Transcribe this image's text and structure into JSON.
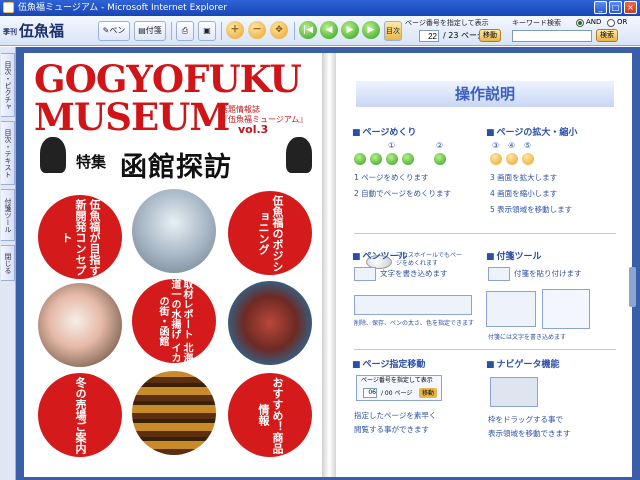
{
  "window": {
    "title": "伍魚福ミュージアム - Microsoft Internet Explorer",
    "buttons": {
      "minimize": "_",
      "maximize": "□",
      "close": "×"
    }
  },
  "toolbar": {
    "logo_small": "季刊",
    "logo_main": "伍魚福",
    "pen_label": "ペン",
    "sticky_label": "付箋",
    "icons": [
      "pen-icon",
      "sticky-icon",
      "print-icon",
      "pdf-icon",
      "zoom-in-icon",
      "zoom-out-icon",
      "move-icon",
      "first-page-icon",
      "prev-page-icon",
      "auto-play-icon",
      "next-page-icon",
      "last-page-icon",
      "index-icon"
    ],
    "zoom_symbols": [
      "＋",
      "－",
      "✥"
    ],
    "nav_symbols": [
      "|◀",
      "◀",
      "▶",
      "▶",
      "▶|"
    ],
    "index_label": "目次",
    "page_prompt": "ページ番号を指定して表示",
    "page_value": "22",
    "page_total": "/ 23 ページ",
    "go_label": "移動",
    "search_label": "キーワード検索",
    "search_and": "AND",
    "search_or": "OR",
    "search_btn": "検索"
  },
  "sidetabs": [
    "目次・ピクチャ",
    "目次・テキスト",
    "付箋ツール",
    "閉じる"
  ],
  "cover": {
    "title1": "GOGYOFUKU",
    "title2": "MUSEUM",
    "subtitle": "話題情報誌",
    "subtitle2": "『伍魚福ミュージアム』",
    "vol": "vol.3",
    "special_label": "特集",
    "special_title": "函館探訪",
    "circle1": "伍魚福が目指す新開発コンセプト",
    "circle2": "伍魚福のポジショニング",
    "circle3": "取材レポート 北海道一の水揚げ イカの街・函館",
    "circle4": "冬の売場ご案内",
    "circle5": "おすすめ！商品情報"
  },
  "howto": {
    "header": "操作説明",
    "sec_page": "ページめくり",
    "page_nums": [
      "①",
      "②"
    ],
    "page_items": [
      "1 ページをめくります",
      "2 自動でページをめくります"
    ],
    "mouse_note": "マウスホイールでもページをめくれます",
    "sec_zoom": "ページの拡大・縮小",
    "zoom_nums": [
      "③",
      "④",
      "⑤"
    ],
    "zoom_items": [
      "3 画面を拡大します",
      "4 画面を縮小します",
      "5 表示領域を移動します"
    ],
    "sec_pen": "ペンツール",
    "pen_item": "文字を書き込めます",
    "pen_note": "削除、保存、ペンの太さ、色を指定できます",
    "sec_sticky": "付箋ツール",
    "sticky_item": "付箋を貼り付けます",
    "sticky_note": "付箋には文字を書き込めます",
    "sec_pagejump": "ページ指定移動",
    "jump_prompt": "ページ番号を指定して表示",
    "jump_value": "06",
    "jump_total": "/ 00 ページ",
    "jump_go": "移動",
    "jump_items": [
      "指定したページを素早く",
      "閲覧する事ができます"
    ],
    "sec_navi": "ナビゲータ機能",
    "navi_items": [
      "枠をドラッグする事で",
      "表示領域を移動できます"
    ]
  }
}
